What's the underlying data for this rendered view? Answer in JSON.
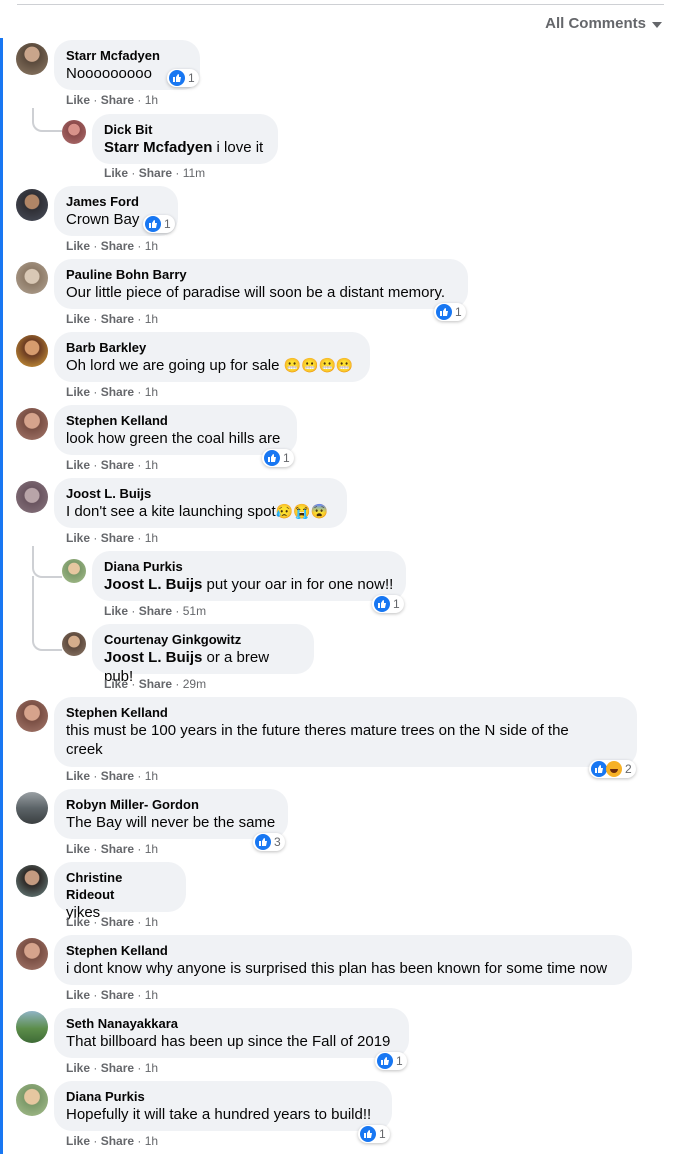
{
  "header": {
    "filter_label": "All Comments"
  },
  "actions": {
    "like": "Like",
    "share": "Share",
    "sep": "·"
  },
  "colors": {
    "accent": "#1877f2",
    "bubble": "#f0f2f5",
    "meta": "#65676b"
  },
  "comments": [
    {
      "name": "Starr Mcfadyen",
      "text": "Nooooooooo",
      "time": "1h",
      "reactions": "1"
    },
    {
      "name": "Dick Bit",
      "mention": "Starr Mcfadyen",
      "text": " i love it",
      "time": "11m"
    },
    {
      "name": "James Ford",
      "text": "Crown Bay",
      "time": "1h",
      "reactions": "1"
    },
    {
      "name": "Pauline Bohn Barry",
      "text": "Our little piece of paradise will soon be a distant memory.",
      "time": "1h",
      "reactions": "1"
    },
    {
      "name": "Barb Barkley",
      "text": "Oh lord we are going up for sale ",
      "emoji": "😬😬😬😬",
      "time": "1h"
    },
    {
      "name": "Stephen Kelland",
      "text": "look how green the coal hills are",
      "time": "1h",
      "reactions": "1"
    },
    {
      "name": "Joost L. Buijs",
      "text": "I don't see a kite launching spot",
      "emoji": "😥😭😨",
      "time": "1h"
    },
    {
      "name": "Diana Purkis",
      "mention": "Joost L. Buijs",
      "text": " put your oar in for one now!!",
      "time": "51m",
      "reactions": "1"
    },
    {
      "name": "Courtenay Ginkgowitz",
      "mention": "Joost L. Buijs",
      "text": " or a brew pub!",
      "time": "29m"
    },
    {
      "name": "Stephen Kelland",
      "text": "this must be 100 years in the future theres mature trees on the N side of the",
      "text2": "creek",
      "time": "1h",
      "reactions": "2"
    },
    {
      "name": "Robyn Miller- Gordon",
      "text": "The Bay will never be the same",
      "time": "1h",
      "reactions": "3"
    },
    {
      "name": "Christine Rideout",
      "text": "yikes",
      "time": "1h"
    },
    {
      "name": "Stephen Kelland",
      "text": "i dont know why anyone is surprised this plan has been known for some time now",
      "time": "1h"
    },
    {
      "name": "Seth Nanayakkara",
      "text": "That billboard has been up since the Fall of 2019",
      "time": "1h",
      "reactions": "1"
    },
    {
      "name": "Diana Purkis",
      "text": "Hopefully it will take a hundred years to build!!",
      "time": "1h",
      "reactions": "1"
    }
  ]
}
